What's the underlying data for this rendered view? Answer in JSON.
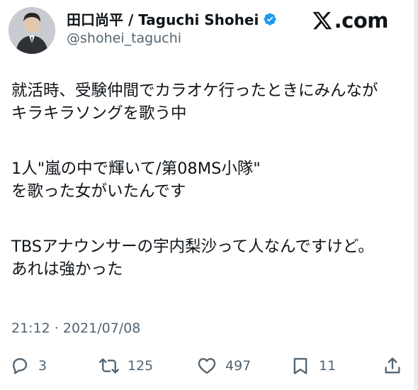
{
  "author": {
    "display_name": "田口尚平 / Taguchi Shohei",
    "handle": "@shohei_taguchi",
    "verified": true
  },
  "brand": {
    "text": ".com",
    "icon": "x-logo-icon"
  },
  "tweet": {
    "lines": [
      "就活時、受験仲間でカラオケ行ったときにみんなが",
      "キラキラソングを歌う中",
      "1人\"嵐の中で輝いて/第08MS小隊\"",
      "を歌った女がいたんです",
      "TBSアナウンサーの宇内梨沙って人なんですけど。",
      "あれは強かった"
    ],
    "timestamp": "21:12 · 2021/07/08"
  },
  "actions": {
    "reply": {
      "icon": "reply-icon",
      "count": "3"
    },
    "retweet": {
      "icon": "retweet-icon",
      "count": "125"
    },
    "like": {
      "icon": "heart-icon",
      "count": "497"
    },
    "bookmark": {
      "icon": "bookmark-icon",
      "count": "11"
    },
    "share": {
      "icon": "share-icon"
    }
  },
  "colors": {
    "text_primary": "#0f1419",
    "text_secondary": "#536471",
    "verified_blue": "#1d9bf0"
  }
}
